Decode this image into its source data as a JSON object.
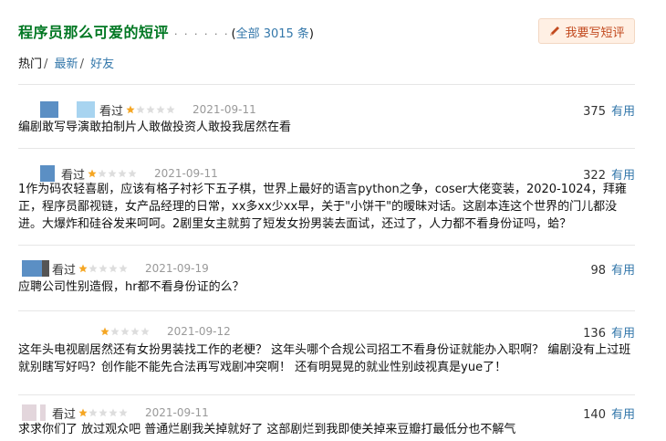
{
  "header": {
    "title": "程序员那么可爱的短评",
    "dots": "· · · · · ·",
    "total_prefix": "(",
    "total_link": "全部 3015 条",
    "total_suffix": ")"
  },
  "write_button": {
    "label": "我要写短评",
    "icon": "pencil-icon"
  },
  "tabs": {
    "hot": "热门",
    "latest": "最新",
    "friends": "好友",
    "sep": "/"
  },
  "colors": {
    "title": "#007722",
    "link": "#3377aa",
    "star_on": "#f5a623",
    "star_off": "#dddddd",
    "button_bg": "#fff0e4",
    "button_text": "#c24a1f"
  },
  "reviews": [
    {
      "status": "看过",
      "rating": 1,
      "date": "2021-09-11",
      "count": "375",
      "useful": "有用",
      "content": "编剧敢写导演敢拍制片人敢做投资人敢投我居然在看"
    },
    {
      "status": "看过",
      "rating": 1,
      "date": "2021-09-11",
      "count": "322",
      "useful": "有用",
      "content": "1作为码农轻喜剧，应该有格子衬衫下五子棋，世界上最好的语言python之争，coser大佬变装，2020-1024，拜雍正，程序员鄙视链，女产品经理的日常，xx多xx少xx早，关于\"小饼干\"的暧昧对话。这剧本连这个世界的门儿都没进。大爆炸和硅谷发来呵呵。2剧里女主就剪了短发女扮男装去面试，还过了，人力都不看身份证吗，蛤？"
    },
    {
      "status": "看过",
      "rating": 1,
      "date": "2021-09-19",
      "count": "98",
      "useful": "有用",
      "content": "应聘公司性别造假，hr都不看身份证的么？"
    },
    {
      "status": "",
      "rating": 1,
      "date": "2021-09-12",
      "count": "136",
      "useful": "有用",
      "content": "这年头电视剧居然还有女扮男装找工作的老梗？ 这年头哪个合规公司招工不看身份证就能办入职啊？ 编剧没有上过班就别瞎写好吗？创作能不能先合法再写戏剧冲突啊！ 还有明晃晃的就业性别歧视真是yue了！"
    },
    {
      "status": "看过",
      "rating": 1,
      "date": "2021-09-11",
      "count": "140",
      "useful": "有用",
      "content": "求求你们了 放过观众吧 普通烂剧我关掉就好了 这部剧烂到我即使关掉来豆瓣打最低分也不解气"
    }
  ]
}
